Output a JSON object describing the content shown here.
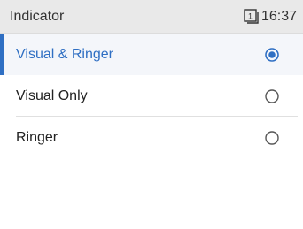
{
  "status_bar": {
    "title": "Indicator",
    "line_number": "1",
    "time": "16:37"
  },
  "options": [
    {
      "label": "Visual & Ringer",
      "selected": true
    },
    {
      "label": "Visual Only",
      "selected": false
    },
    {
      "label": "Ringer",
      "selected": false
    }
  ],
  "colors": {
    "accent": "#2f6fc3",
    "status_bar_bg": "#e9e9e9",
    "radio_border": "#555555"
  },
  "icons": {
    "line": "line-indicator-icon",
    "radio_selected": "radio-selected-icon",
    "radio_unselected": "radio-unselected-icon"
  }
}
